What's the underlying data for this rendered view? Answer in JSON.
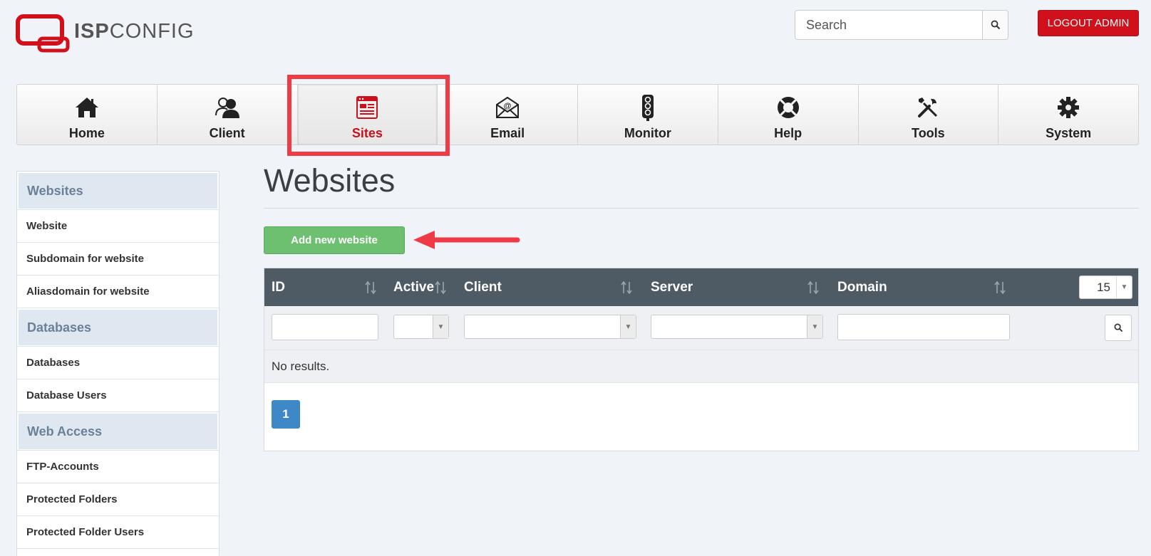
{
  "header": {
    "logo_text_bold": "ISP",
    "logo_text_light": "CONFIG",
    "search_placeholder": "Search",
    "logout_label": "LOGOUT ADMIN"
  },
  "nav": {
    "items": [
      {
        "label": "Home",
        "icon": "home-icon"
      },
      {
        "label": "Client",
        "icon": "client-icon"
      },
      {
        "label": "Sites",
        "icon": "sites-icon",
        "active": true
      },
      {
        "label": "Email",
        "icon": "email-icon"
      },
      {
        "label": "Monitor",
        "icon": "monitor-icon"
      },
      {
        "label": "Help",
        "icon": "help-icon"
      },
      {
        "label": "Tools",
        "icon": "tools-icon"
      },
      {
        "label": "System",
        "icon": "system-icon"
      }
    ]
  },
  "sidebar": {
    "sections": [
      {
        "title": "Websites",
        "items": [
          "Website",
          "Subdomain for website",
          "Aliasdomain for website"
        ]
      },
      {
        "title": "Databases",
        "items": [
          "Databases",
          "Database Users"
        ]
      },
      {
        "title": "Web Access",
        "items": [
          "FTP-Accounts",
          "Protected Folders",
          "Protected Folder Users"
        ]
      }
    ]
  },
  "main": {
    "title": "Websites",
    "add_button_label": "Add new website",
    "table": {
      "columns": [
        "ID",
        "Active",
        "Client",
        "Server",
        "Domain"
      ],
      "per_page": "15",
      "empty_text": "No results.",
      "current_page": "1"
    }
  },
  "colors": {
    "accent_red": "#d0111b",
    "highlight": "#ee3b46",
    "add_green": "#6cc070",
    "table_header": "#4f5b64",
    "pager_blue": "#3f88c7"
  }
}
